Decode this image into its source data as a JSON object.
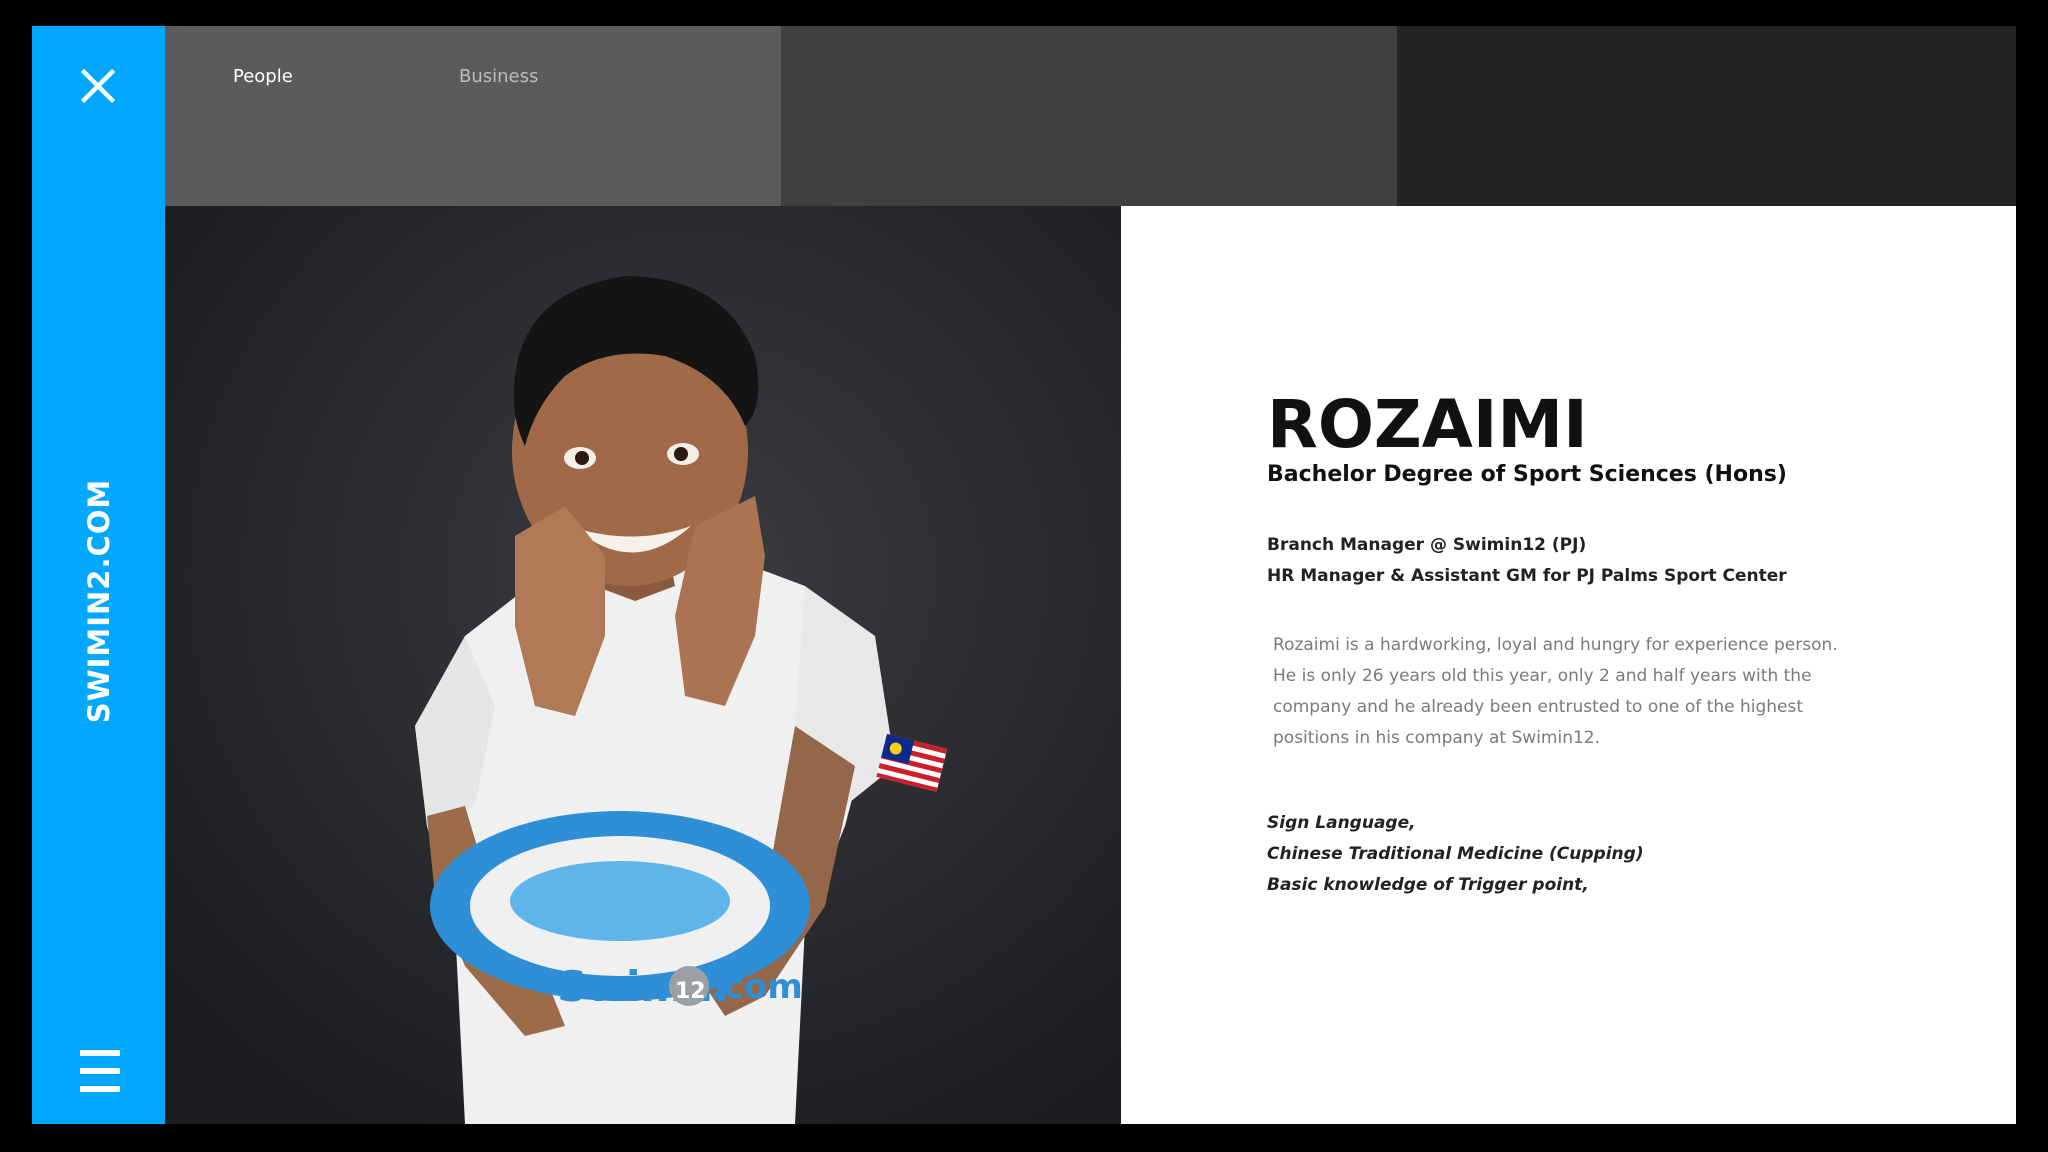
{
  "nav": {
    "close_icon": "close-icon",
    "menu_icon": "hamburger-menu-icon",
    "brand_vertical": "SWIMIN2.COM",
    "tabs": [
      {
        "label": "People",
        "active": true
      },
      {
        "label": "Business",
        "active": false
      }
    ]
  },
  "photo": {
    "shirt_logo_text": "Swimin",
    "shirt_logo_number": "12",
    "shirt_logo_suffix": ".com"
  },
  "profile": {
    "name": "ROZAIMI",
    "degree": "Bachelor Degree of Sport Sciences (Hons)",
    "roles": [
      "Branch Manager @ Swimin12 (PJ)",
      "HR Manager & Assistant GM for PJ Palms Sport Center"
    ],
    "bio_lines": [
      "Rozaimi is a hardworking, loyal and hungry for experience person.",
      "He is only 26 years old this year, only 2 and half years with the",
      "company and he already been entrusted to one of the highest",
      "positions in his company at Swimin12."
    ],
    "skills": [
      "Sign Language,",
      "Chinese Traditional Medicine (Cupping)",
      "Basic knowledge of Trigger point,"
    ]
  },
  "colors": {
    "accent": "#00a8ff",
    "tab_block_1": "#5b5b5b",
    "tab_block_2": "#404040",
    "tab_block_3": "#242424"
  }
}
